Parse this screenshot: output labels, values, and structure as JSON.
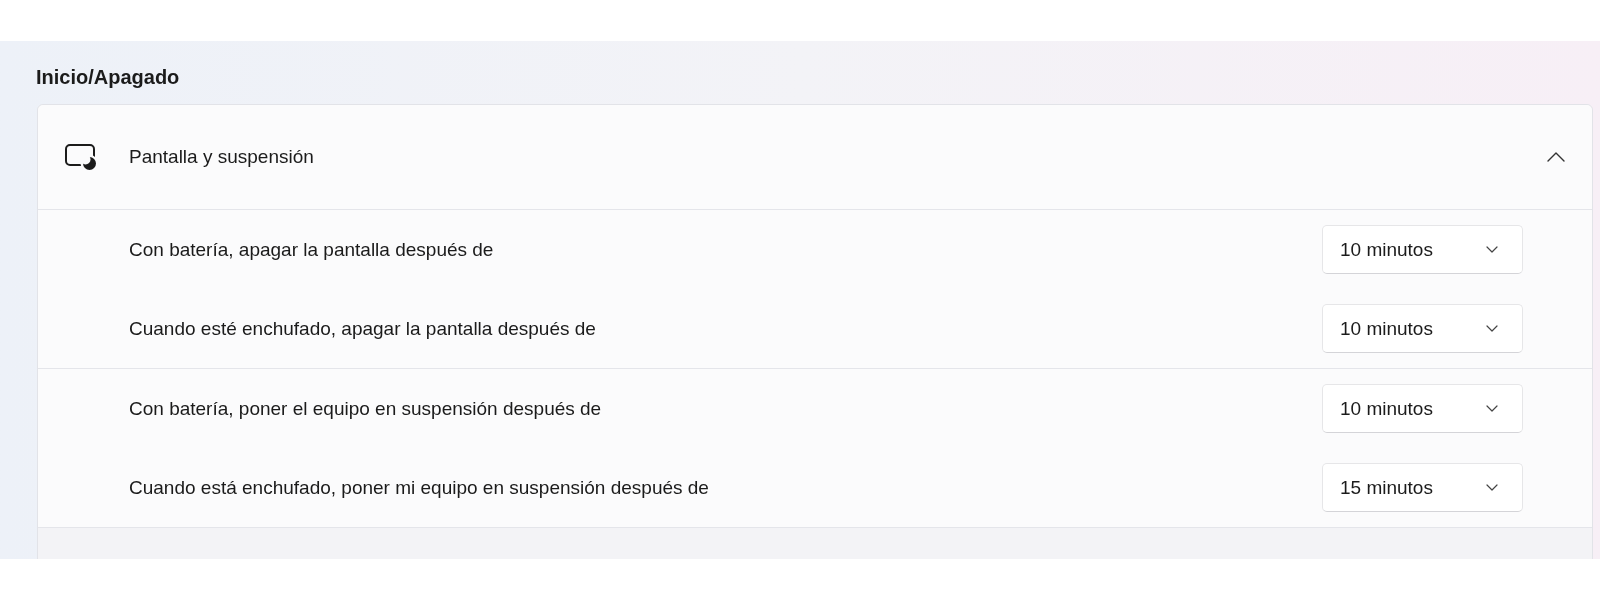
{
  "heading": "Inicio/Apagado",
  "sections": [
    {
      "title": "Pantalla y suspensión",
      "expanded": true,
      "groups": [
        {
          "settings": [
            {
              "label": "Con batería, apagar la pantalla después de",
              "value": "10 minutos"
            },
            {
              "label": "Cuando esté enchufado, apagar la pantalla después de",
              "value": "10 minutos"
            }
          ]
        },
        {
          "settings": [
            {
              "label": "Con batería, poner el equipo en suspensión después de",
              "value": "10 minutos"
            },
            {
              "label": "Cuando está enchufado, poner mi equipo en suspensión después de",
              "value": "15 minutos"
            }
          ]
        }
      ]
    }
  ]
}
